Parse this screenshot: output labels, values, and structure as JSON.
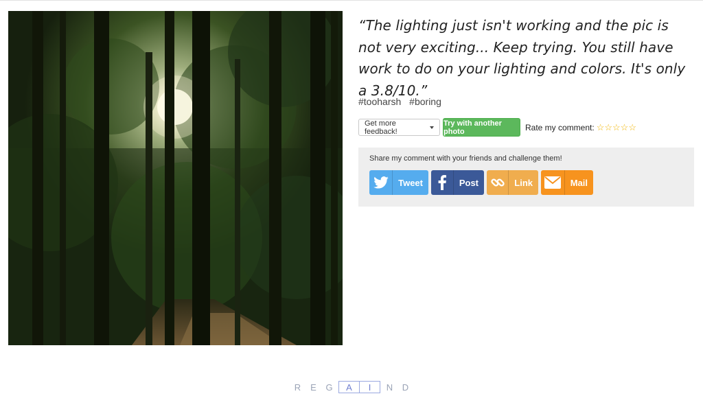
{
  "photo": {
    "description_icon": "forest-photo-icon"
  },
  "quote": "“The lighting just isn't working and the pic is not very exciting... Keep trying. You still have work to do on your lighting and colors. It's only a 3.8/10.”",
  "tags": [
    "#tooharsh",
    "#boring"
  ],
  "actions": {
    "feedback_dropdown": "Get more feedback!",
    "try_button": "Try with another photo",
    "rate_label": "Rate my comment:",
    "rating": {
      "value": 0,
      "max": 5
    }
  },
  "share": {
    "title": "Share my comment with your friends and challenge them!",
    "buttons": [
      {
        "label": "Tweet",
        "icon": "twitter-icon",
        "color": "#55acee"
      },
      {
        "label": "Post",
        "icon": "facebook-icon",
        "color": "#3b5998"
      },
      {
        "label": "Link",
        "icon": "link-icon",
        "color": "#f0ad4e"
      },
      {
        "label": "Mail",
        "icon": "mail-icon",
        "color": "#f7931e"
      }
    ]
  },
  "brand": {
    "letters": [
      "R",
      "E",
      "G",
      "A",
      "I",
      "N",
      "D"
    ]
  }
}
